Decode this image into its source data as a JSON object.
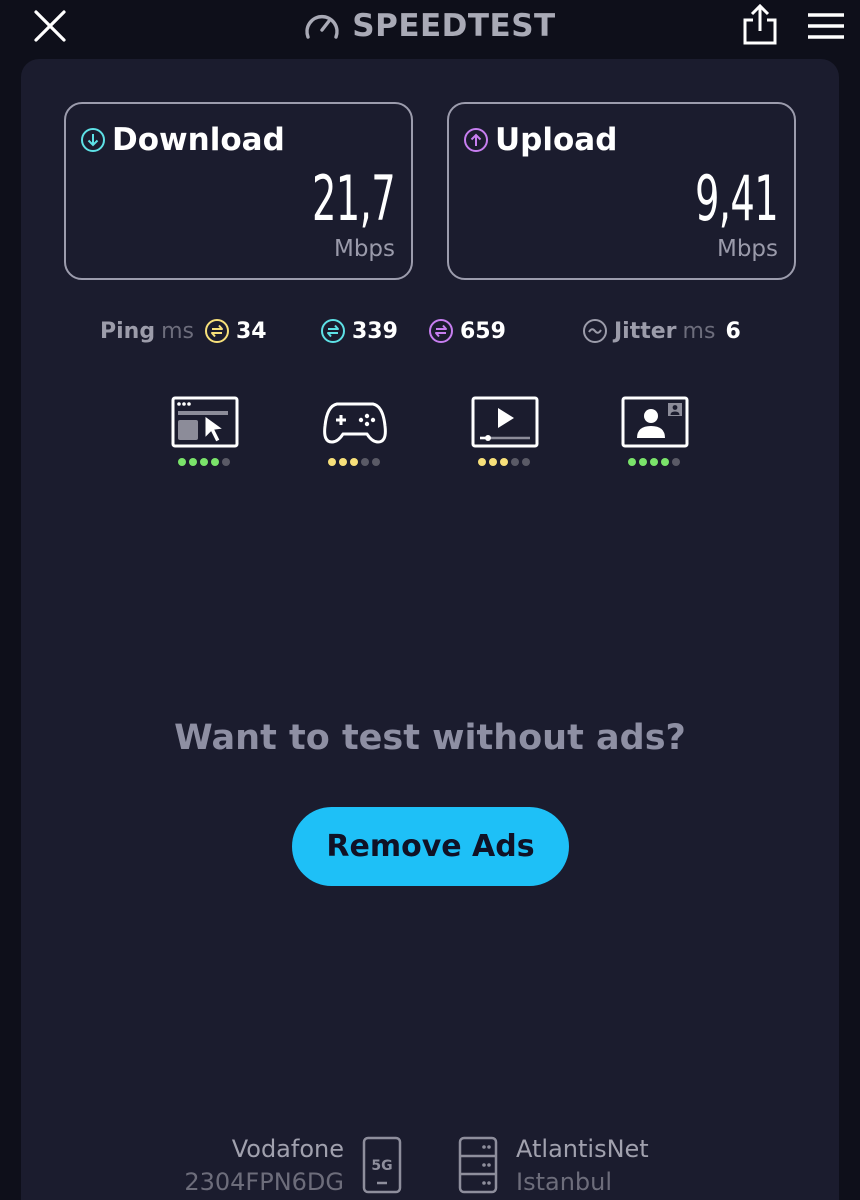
{
  "header": {
    "brand": "SPEEDTEST",
    "icons": [
      "close-icon",
      "speedometer-icon",
      "share-icon",
      "menu-icon"
    ]
  },
  "download": {
    "title": "Download",
    "value": "21,7",
    "unit": "Mbps",
    "icon": "arrow-down-circle-icon",
    "color": "#5ee1e6"
  },
  "upload": {
    "title": "Upload",
    "value": "9,41",
    "unit": "Mbps",
    "icon": "arrow-up-circle-icon",
    "color": "#c77ef0"
  },
  "ping": {
    "label": "Ping",
    "unit": "ms",
    "idle": {
      "value": "34",
      "color": "#f7e07a"
    },
    "download": {
      "value": "339",
      "color": "#5ee1e6"
    },
    "upload": {
      "value": "659",
      "color": "#c77ef0"
    }
  },
  "jitter": {
    "label": "Jitter",
    "unit": "ms",
    "value": "6"
  },
  "use_cases": [
    {
      "name": "web-browsing-icon",
      "rating": 4,
      "color": "#7ae36a"
    },
    {
      "name": "gaming-icon",
      "rating": 3,
      "color": "#f7e07a"
    },
    {
      "name": "video-streaming-icon",
      "rating": 3,
      "color": "#f7e07a"
    },
    {
      "name": "video-call-icon",
      "rating": 4,
      "color": "#7ae36a"
    }
  ],
  "promo": {
    "text": "Want to test without ads?",
    "button": "Remove Ads",
    "button_color": "#1ec0f7"
  },
  "provider": {
    "name": "Vodafone",
    "device": "2304FPN6DG",
    "network": "5G"
  },
  "server": {
    "name": "AtlantisNet",
    "location": "Istanbul"
  }
}
